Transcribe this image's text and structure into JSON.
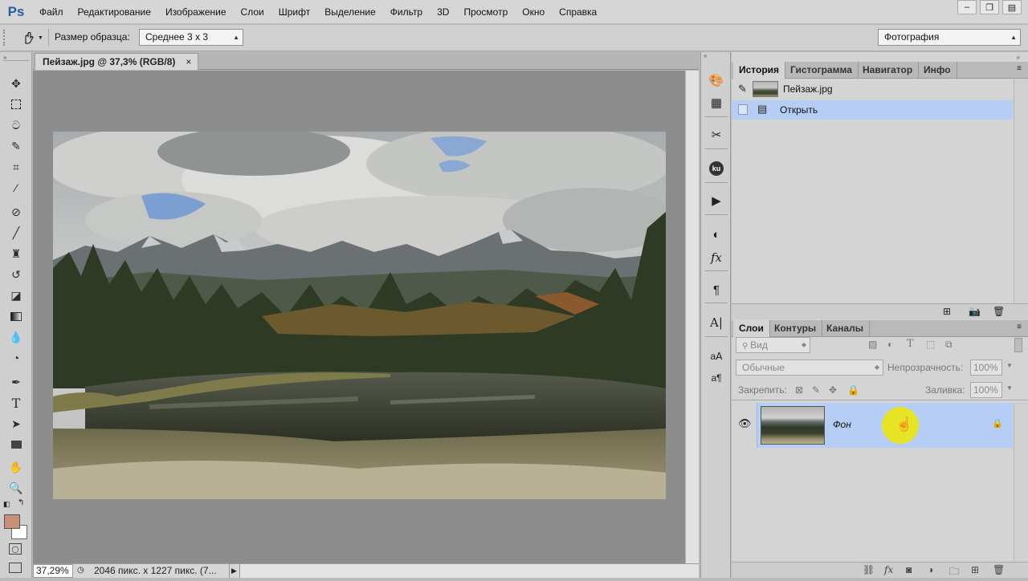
{
  "app": {
    "logo": "Ps"
  },
  "menu": [
    "Файл",
    "Редактирование",
    "Изображение",
    "Слои",
    "Шрифт",
    "Выделение",
    "Фильтр",
    "3D",
    "Просмотр",
    "Окно",
    "Справка"
  ],
  "options": {
    "sample_size_label": "Размер образца:",
    "sample_size_value": "Среднее 3 x 3",
    "workspace": "Фотография"
  },
  "document": {
    "tab_title": "Пейзаж.jpg @ 37,3% (RGB/8)",
    "close": "×",
    "zoom": "37,29%",
    "dimensions": "2046 пикс. x 1227 пикс. (7..."
  },
  "history_panel": {
    "tabs": [
      "История",
      "Гистограмма",
      "Навигатор",
      "Инфо"
    ],
    "snapshot_name": "Пейзаж.jpg",
    "steps": [
      "Открыть"
    ]
  },
  "layers_panel": {
    "tabs": [
      "Слои",
      "Контуры",
      "Каналы"
    ],
    "filter_kind": "Вид",
    "blend_mode": "Обычные",
    "opacity_label": "Непрозрачность:",
    "opacity_value": "100%",
    "lock_label": "Закрепить:",
    "fill_label": "Заливка:",
    "fill_value": "100%",
    "layers": [
      {
        "name": "Фон",
        "visible": true,
        "locked": true
      }
    ]
  },
  "colors": {
    "accent_selection": "#b6cdf6",
    "foreground_swatch": "#c89077",
    "background_swatch": "#ffffff",
    "cursor_highlight": "#f0e800"
  },
  "icons": {
    "toolbar": [
      "move-icon",
      "marquee-icon",
      "lasso-icon",
      "quick-selection-icon",
      "crop-icon",
      "eyedropper-icon",
      "healing-brush-icon",
      "brush-icon",
      "clone-stamp-icon",
      "history-brush-icon",
      "eraser-icon",
      "gradient-icon",
      "blur-icon",
      "dodge-icon",
      "pen-icon",
      "type-icon",
      "path-selection-icon",
      "rectangle-icon",
      "hand-icon",
      "zoom-icon"
    ]
  }
}
